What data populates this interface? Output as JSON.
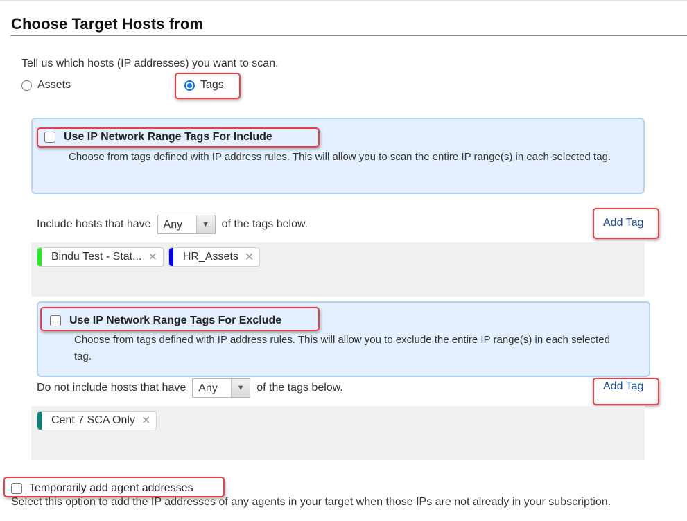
{
  "section": {
    "title": "Choose Target Hosts from",
    "intro": "Tell us which hosts (IP addresses) you want to scan."
  },
  "target_type": {
    "options": [
      {
        "label": "Assets",
        "selected": false
      },
      {
        "label": "Tags",
        "selected": true
      }
    ]
  },
  "include": {
    "ip_range_checkbox": {
      "label": "Use IP Network Range Tags For Include",
      "checked": false,
      "description": "Choose from tags defined with IP address rules. This will allow you to scan the entire IP range(s) in each selected tag."
    },
    "filter_prefix": "Include hosts that have",
    "match_selected": "Any",
    "filter_suffix": "of the tags below.",
    "add_tag_label": "Add Tag",
    "tags": [
      {
        "label": "Bindu Test - Stat...",
        "color": "#22ee22"
      },
      {
        "label": "HR_Assets",
        "color": "#0000ee"
      }
    ]
  },
  "exclude": {
    "ip_range_checkbox": {
      "label": "Use IP Network Range Tags For Exclude",
      "checked": false,
      "description": "Choose from tags defined with IP address rules. This will allow you to exclude the entire IP range(s) in each selected tag."
    },
    "filter_prefix": "Do not include hosts that have",
    "match_selected": "Any",
    "filter_suffix": "of the tags below.",
    "add_tag_label": "Add Tag",
    "tags": [
      {
        "label": "Cent 7 SCA Only",
        "color": "#00857a"
      }
    ]
  },
  "agent_addresses": {
    "label": "Temporarily add agent addresses",
    "checked": false,
    "description": "Select this option to add the IP addresses of any agents in your target when those IPs are not already in your subscription."
  },
  "icons": {
    "tag_remove": "✕",
    "select_arrow": "▼"
  },
  "colors": {
    "highlight": "#ee3d43",
    "info_box_bg": "#e4efff",
    "info_box_border": "#b5d3f5",
    "link": "#1a4d9c",
    "radio_selected": "#0a6ef5"
  }
}
